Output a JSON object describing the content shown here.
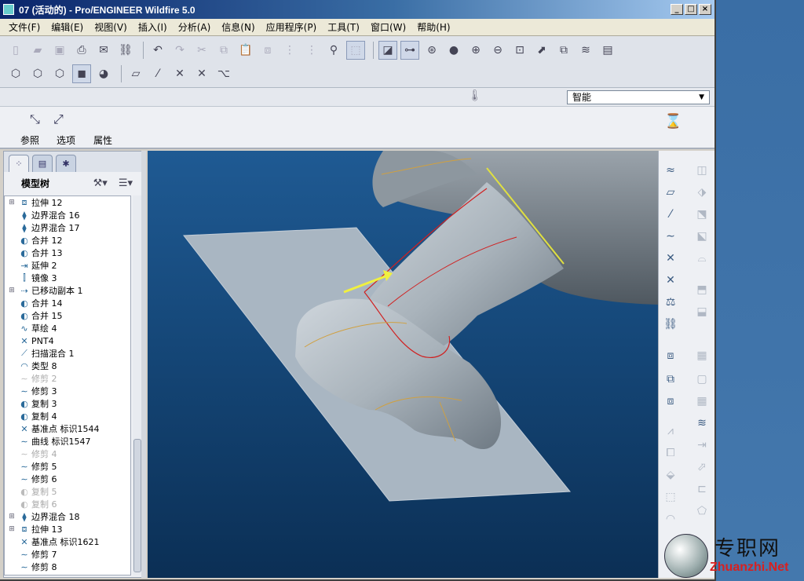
{
  "window": {
    "title": "07 (活动的) - Pro/ENGINEER Wildfire 5.0",
    "buttons": {
      "minimize": "_",
      "maximize": "□",
      "close": "×"
    }
  },
  "menu": [
    "文件(F)",
    "编辑(E)",
    "视图(V)",
    "插入(I)",
    "分析(A)",
    "信息(N)",
    "应用程序(P)",
    "工具(T)",
    "窗口(W)",
    "帮助(H)"
  ],
  "filter": {
    "selected": "智能"
  },
  "dashboard": {
    "tabs": [
      "参照",
      "选项",
      "属性"
    ]
  },
  "model_tree": {
    "title": "模型树",
    "items": [
      {
        "label": "拉伸 12",
        "expandable": true,
        "suppressed": false,
        "icon": "extrude-icon"
      },
      {
        "label": "边界混合 16",
        "expandable": false,
        "suppressed": false,
        "icon": "boundary-blend-icon"
      },
      {
        "label": "边界混合 17",
        "expandable": false,
        "suppressed": false,
        "icon": "boundary-blend-icon"
      },
      {
        "label": "合并 12",
        "expandable": false,
        "suppressed": false,
        "icon": "merge-icon"
      },
      {
        "label": "合并 13",
        "expandable": false,
        "suppressed": false,
        "icon": "merge-icon"
      },
      {
        "label": "延伸 2",
        "expandable": false,
        "suppressed": false,
        "icon": "extend-icon"
      },
      {
        "label": "镜像 3",
        "expandable": false,
        "suppressed": false,
        "icon": "mirror-icon"
      },
      {
        "label": "已移动副本 1",
        "expandable": true,
        "suppressed": false,
        "icon": "moved-copy-icon"
      },
      {
        "label": "合并 14",
        "expandable": false,
        "suppressed": false,
        "icon": "merge-icon"
      },
      {
        "label": "合并 15",
        "expandable": false,
        "suppressed": false,
        "icon": "merge-icon"
      },
      {
        "label": "草绘 4",
        "expandable": false,
        "suppressed": false,
        "icon": "sketch-icon"
      },
      {
        "label": "PNT4",
        "expandable": false,
        "suppressed": false,
        "icon": "datum-point-icon"
      },
      {
        "label": "扫描混合 1",
        "expandable": false,
        "suppressed": false,
        "icon": "swept-blend-icon"
      },
      {
        "label": "类型 8",
        "expandable": false,
        "suppressed": false,
        "icon": "type-icon"
      },
      {
        "label": "修剪 2",
        "expandable": false,
        "suppressed": true,
        "icon": "trim-icon"
      },
      {
        "label": "修剪 3",
        "expandable": false,
        "suppressed": false,
        "icon": "trim-icon"
      },
      {
        "label": "复制 3",
        "expandable": false,
        "suppressed": false,
        "icon": "copy-icon"
      },
      {
        "label": "复制 4",
        "expandable": false,
        "suppressed": false,
        "icon": "copy-icon"
      },
      {
        "label": "基准点 标识1544",
        "expandable": false,
        "suppressed": false,
        "icon": "datum-point-icon"
      },
      {
        "label": "曲线 标识1547",
        "expandable": false,
        "suppressed": false,
        "icon": "curve-icon"
      },
      {
        "label": "修剪 4",
        "expandable": false,
        "suppressed": true,
        "icon": "trim-icon"
      },
      {
        "label": "修剪 5",
        "expandable": false,
        "suppressed": false,
        "icon": "trim-icon"
      },
      {
        "label": "修剪 6",
        "expandable": false,
        "suppressed": false,
        "icon": "trim-icon"
      },
      {
        "label": "复制 5",
        "expandable": false,
        "suppressed": true,
        "icon": "copy-icon"
      },
      {
        "label": "复制 6",
        "expandable": false,
        "suppressed": true,
        "icon": "copy-icon"
      },
      {
        "label": "边界混合 18",
        "expandable": true,
        "suppressed": false,
        "icon": "boundary-blend-icon"
      },
      {
        "label": "拉伸 13",
        "expandable": true,
        "suppressed": false,
        "icon": "extrude-icon"
      },
      {
        "label": "基准点 标识1621",
        "expandable": false,
        "suppressed": false,
        "icon": "datum-point-icon"
      },
      {
        "label": "修剪 7",
        "expandable": false,
        "suppressed": false,
        "icon": "trim-icon"
      },
      {
        "label": "修剪 8",
        "expandable": false,
        "suppressed": false,
        "icon": "trim-icon"
      }
    ]
  },
  "watermark": {
    "cn": "专职网",
    "en": "Zhuanzhi.Net"
  },
  "colors": {
    "viewport_top": "#1f5a93",
    "viewport_bottom": "#0b2f55",
    "highlight": "#e0e040",
    "selected_edge": "#d02020"
  }
}
